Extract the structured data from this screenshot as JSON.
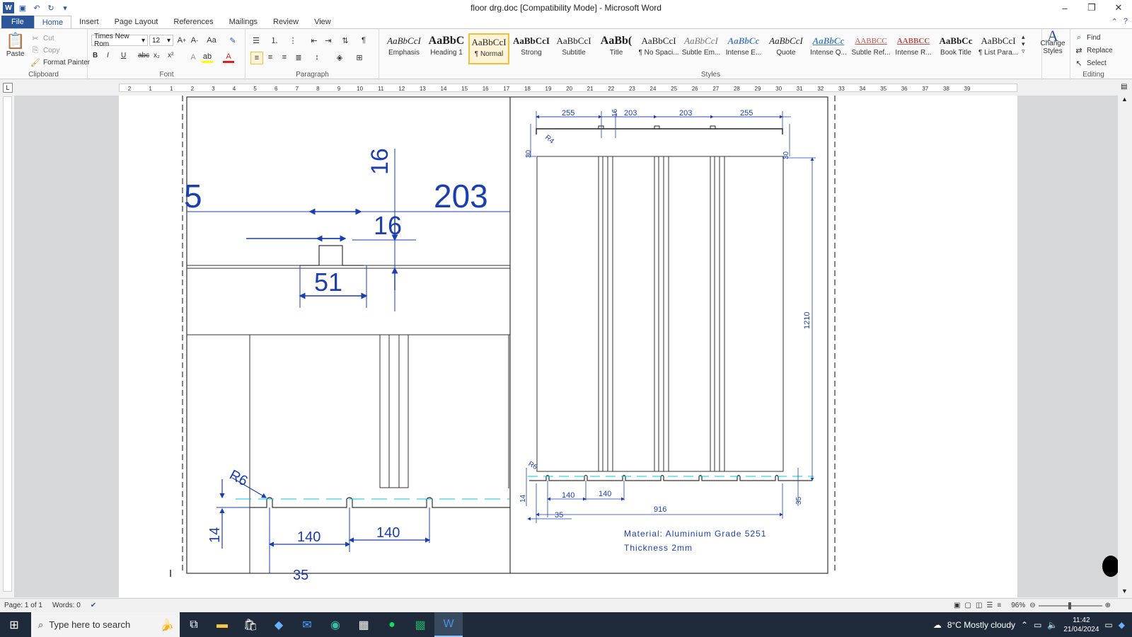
{
  "window": {
    "title": "floor drg.doc [Compatibility Mode] - Microsoft Word"
  },
  "qat": {
    "icons": [
      "word-icon",
      "save-icon",
      "undo-icon",
      "redo-icon",
      "customize-icon"
    ]
  },
  "tabs": [
    "File",
    "Home",
    "Insert",
    "Page Layout",
    "References",
    "Mailings",
    "Review",
    "View"
  ],
  "active_tab": "Home",
  "clipboard": {
    "paste": "Paste",
    "cut": "Cut",
    "copy": "Copy",
    "format_painter": "Format Painter",
    "label": "Clipboard"
  },
  "font": {
    "name": "Times New Rom",
    "size": "12",
    "label": "Font",
    "bold": "B",
    "italic": "I",
    "underline": "U",
    "strike": "abc",
    "sub": "x₂",
    "sup": "x²"
  },
  "paragraph": {
    "label": "Paragraph"
  },
  "styles": {
    "label": "Styles",
    "items": [
      {
        "preview": "AaBbCcI",
        "name": "Emphasis"
      },
      {
        "preview": "AaBbC",
        "name": "Heading 1"
      },
      {
        "preview": "AaBbCcI",
        "name": "¶ Normal"
      },
      {
        "preview": "AaBbCcI",
        "name": "Strong"
      },
      {
        "preview": "AaBbCcI",
        "name": "Subtitle"
      },
      {
        "preview": "AaBb(",
        "name": "Title"
      },
      {
        "preview": "AaBbCcI",
        "name": "¶ No Spaci..."
      },
      {
        "preview": "AaBbCcI",
        "name": "Subtle Em..."
      },
      {
        "preview": "AaBbCc",
        "name": "Intense E..."
      },
      {
        "preview": "AaBbCcI",
        "name": "Quote"
      },
      {
        "preview": "AaBbCc",
        "name": "Intense Q..."
      },
      {
        "preview": "AABBCC",
        "name": "Subtle Ref..."
      },
      {
        "preview": "AABBCC",
        "name": "Intense R..."
      },
      {
        "preview": "AaBbCc",
        "name": "Book Title"
      },
      {
        "preview": "AaBbCcI",
        "name": "¶ List Para..."
      }
    ],
    "change": "Change Styles"
  },
  "editing": {
    "label": "Editing",
    "find": "Find",
    "replace": "Replace",
    "select": "Select"
  },
  "ruler": {
    "numbers": [
      "2",
      "1",
      "1",
      "2",
      "3",
      "4",
      "5",
      "6",
      "7",
      "8",
      "9",
      "10",
      "11",
      "12",
      "13",
      "14",
      "15",
      "16",
      "17",
      "18",
      "19",
      "20",
      "21",
      "22",
      "23",
      "24",
      "25",
      "26",
      "27",
      "28",
      "29",
      "30",
      "31",
      "32",
      "33",
      "34",
      "35",
      "36",
      "37",
      "38",
      "39"
    ]
  },
  "drawing": {
    "detail": {
      "dims": [
        "203",
        "16",
        "16",
        "5",
        "51",
        "R6",
        "14",
        "140",
        "140",
        "35"
      ]
    },
    "main": {
      "dims": [
        "255",
        "203",
        "203",
        "255",
        "16",
        "R4",
        "30",
        "30",
        "1210",
        "R6",
        "14",
        "140",
        "140",
        "35",
        "916",
        "35"
      ]
    },
    "notes": [
      "Material: Aluminium Grade 5251",
      "Thickness 2mm"
    ]
  },
  "status": {
    "page": "Page: 1 of 1",
    "words": "Words: 0",
    "zoom": "96%"
  },
  "taskbar": {
    "search": "Type here to search",
    "weather": "8°C  Mostly cloudy",
    "time": "11:42",
    "date": "21/04/2024"
  },
  "colors": {
    "accent": "#2b579a",
    "cad_blue": "#1a3fb0",
    "cad_cyan": "#00c8d8"
  }
}
